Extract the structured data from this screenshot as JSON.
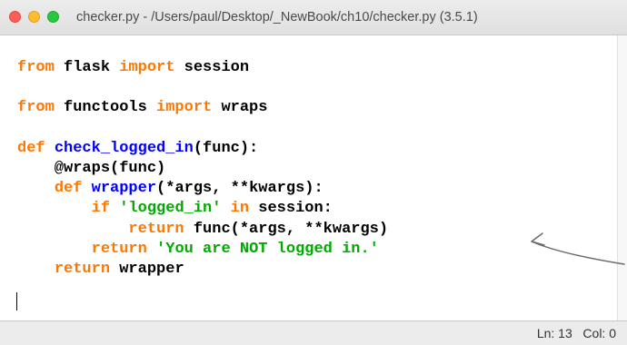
{
  "window": {
    "title": "checker.py - /Users/paul/Desktop/_NewBook/ch10/checker.py (3.5.1)"
  },
  "code": {
    "lines": [
      [
        {
          "t": "from",
          "c": "kw"
        },
        {
          "t": " flask ",
          "c": "plain"
        },
        {
          "t": "import",
          "c": "kw"
        },
        {
          "t": " session",
          "c": "plain"
        }
      ],
      [],
      [
        {
          "t": "from",
          "c": "kw"
        },
        {
          "t": " functools ",
          "c": "plain"
        },
        {
          "t": "import",
          "c": "kw"
        },
        {
          "t": " wraps",
          "c": "plain"
        }
      ],
      [],
      [
        {
          "t": "def",
          "c": "kw"
        },
        {
          "t": " ",
          "c": "plain"
        },
        {
          "t": "check_logged_in",
          "c": "fn"
        },
        {
          "t": "(func):",
          "c": "plain"
        }
      ],
      [
        {
          "t": "    @wraps(func)",
          "c": "plain"
        }
      ],
      [
        {
          "t": "    ",
          "c": "plain"
        },
        {
          "t": "def",
          "c": "kw"
        },
        {
          "t": " ",
          "c": "plain"
        },
        {
          "t": "wrapper",
          "c": "fn"
        },
        {
          "t": "(*args, **kwargs):",
          "c": "plain"
        }
      ],
      [
        {
          "t": "        ",
          "c": "plain"
        },
        {
          "t": "if",
          "c": "kw"
        },
        {
          "t": " ",
          "c": "plain"
        },
        {
          "t": "'logged_in'",
          "c": "str"
        },
        {
          "t": " ",
          "c": "plain"
        },
        {
          "t": "in",
          "c": "kw"
        },
        {
          "t": " session:",
          "c": "plain"
        }
      ],
      [
        {
          "t": "            ",
          "c": "plain"
        },
        {
          "t": "return",
          "c": "kw"
        },
        {
          "t": " func(*args, **kwargs)",
          "c": "plain"
        }
      ],
      [
        {
          "t": "        ",
          "c": "plain"
        },
        {
          "t": "return",
          "c": "kw"
        },
        {
          "t": " ",
          "c": "plain"
        },
        {
          "t": "'You are NOT logged in.'",
          "c": "str"
        }
      ],
      [
        {
          "t": "    ",
          "c": "plain"
        },
        {
          "t": "return",
          "c": "kw"
        },
        {
          "t": " wrapper",
          "c": "plain"
        }
      ],
      []
    ]
  },
  "status": {
    "line_col": "Ln: 13   Col: 0"
  },
  "colors": {
    "keyword": "#ff7700",
    "definition": "#0000ff",
    "string": "#00aa00",
    "close": "#fd5f57",
    "minimize": "#febc2e",
    "maximize": "#29c840"
  }
}
